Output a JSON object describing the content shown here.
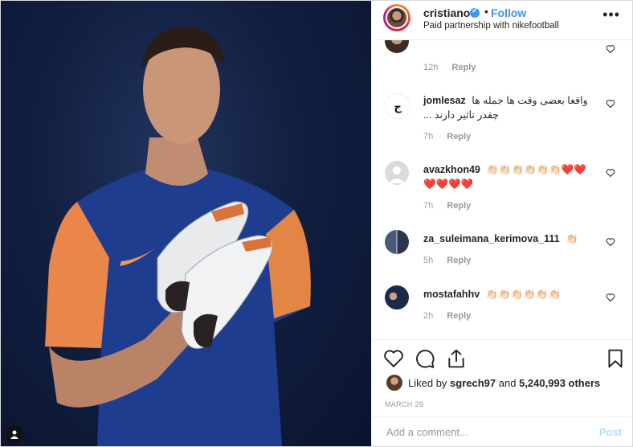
{
  "post": {
    "username": "cristiano",
    "separator": "•",
    "follow_label": "Follow",
    "subtitle": "Paid partnership with nikefootball",
    "more_label": "•••"
  },
  "comments": [
    {
      "id": "partial",
      "username": "",
      "text": "",
      "time": "12h",
      "reply": "Reply"
    },
    {
      "id": "jomlesaz",
      "username": "jomlesaz",
      "text": "واقعا بعضی وقت ها جمله ها چقدر تاثیر دارند ...",
      "time": "7h",
      "reply": "Reply"
    },
    {
      "id": "avazkhon49",
      "username": "avazkhon49",
      "text": "👏🏻👏🏻👏🏻👏🏻👏🏻👏🏻❤️❤️❤️❤️❤️❤️",
      "time": "7h",
      "reply": "Reply"
    },
    {
      "id": "kerimova",
      "username": "za_suleimana_kerimova_111",
      "text": "👏🏻",
      "time": "5h",
      "reply": "Reply"
    },
    {
      "id": "mostafahhv",
      "username": "mostafahhv",
      "text": "👏🏻👏🏻👏🏻👏🏻👏🏻👏🏻",
      "time": "2h",
      "reply": "Reply"
    }
  ],
  "likes": {
    "prefix": "Liked by",
    "user": "sgrech97",
    "and": "and",
    "count": "5,240,993 others"
  },
  "date": "MARCH 29",
  "add_comment": {
    "placeholder": "Add a comment...",
    "post_label": "Post"
  },
  "colors": {
    "accent": "#3897f0",
    "text": "#262626",
    "muted": "#999999",
    "photo_bg": "#121f40"
  },
  "icons": [
    "heart-icon",
    "comment-icon",
    "share-icon",
    "bookmark-icon",
    "verified-icon",
    "user-tag-icon"
  ]
}
